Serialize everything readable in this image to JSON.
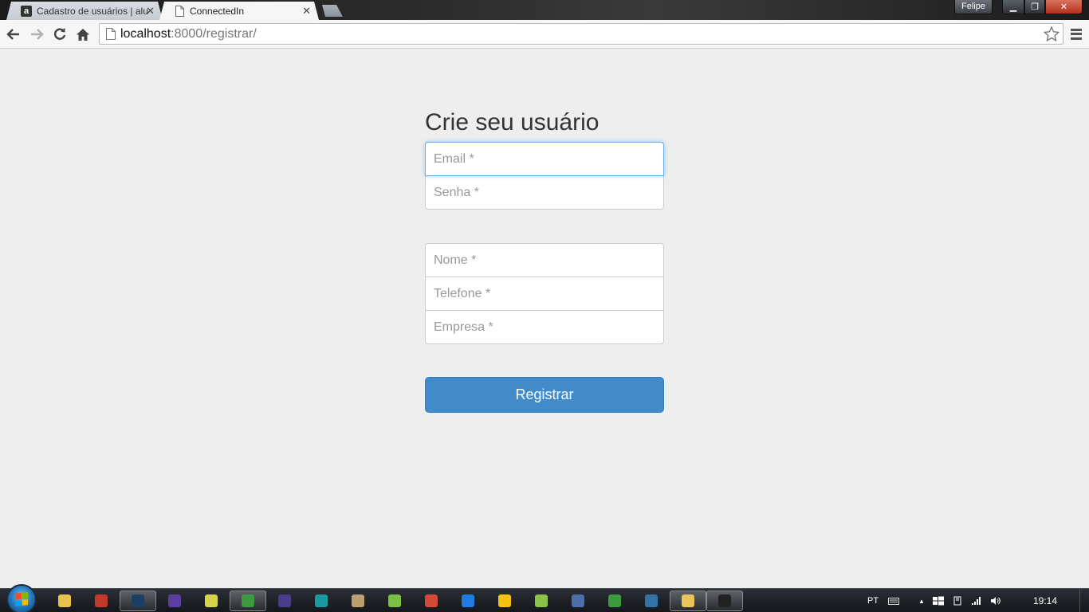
{
  "browser": {
    "tabs": [
      {
        "title": "Cadastro de usuários | alu",
        "favicon": "alura-a-icon",
        "active": false
      },
      {
        "title": "ConnectedIn",
        "favicon": "page-icon",
        "active": true
      }
    ],
    "profile_name": "Felipe",
    "url_host": "localhost",
    "url_rest": ":8000/registrar/"
  },
  "page": {
    "heading": "Crie seu usuário",
    "fields": {
      "email_placeholder": "Email *",
      "password_placeholder": "Senha *",
      "name_placeholder": "Nome *",
      "phone_placeholder": "Telefone *",
      "company_placeholder": "Empresa *"
    },
    "submit_label": "Registrar",
    "accent_color": "#428bca",
    "focus_color": "#66afe9"
  },
  "taskbar": {
    "apps": [
      {
        "name": "windows-explorer-libraries-icon",
        "color": "#e6c34a"
      },
      {
        "name": "gimp-icon",
        "color": "#c0392b"
      },
      {
        "name": "photoshop-icon",
        "color": "#1c3f66",
        "active": true
      },
      {
        "name": "eclipse-icon",
        "color": "#5b3fa0"
      },
      {
        "name": "notepad-icon",
        "color": "#d8d24a"
      },
      {
        "name": "chrome-icon",
        "color": "#3c9b3e",
        "active": true
      },
      {
        "name": "eclipse-2-icon",
        "color": "#4a3d8f"
      },
      {
        "name": "arduino-icon",
        "color": "#1a9aa0"
      },
      {
        "name": "app-icon",
        "color": "#b9a070"
      },
      {
        "name": "android-studio-icon",
        "color": "#7ac143"
      },
      {
        "name": "chrome-dev-icon",
        "color": "#d34836"
      },
      {
        "name": "dropbox-icon",
        "color": "#1f7ce0"
      },
      {
        "name": "google-drive-icon",
        "color": "#f4c20d"
      },
      {
        "name": "android-icon",
        "color": "#8bc34a"
      },
      {
        "name": "sublime-icon",
        "color": "#4b6fa6"
      },
      {
        "name": "app2-icon",
        "color": "#3c9b3e"
      },
      {
        "name": "python-icon",
        "color": "#3572a5"
      },
      {
        "name": "explorer-icon",
        "color": "#e8c45a",
        "active": true
      },
      {
        "name": "cmd-icon",
        "color": "#222",
        "active": true
      }
    ],
    "language": "PT",
    "time": "19:14"
  }
}
